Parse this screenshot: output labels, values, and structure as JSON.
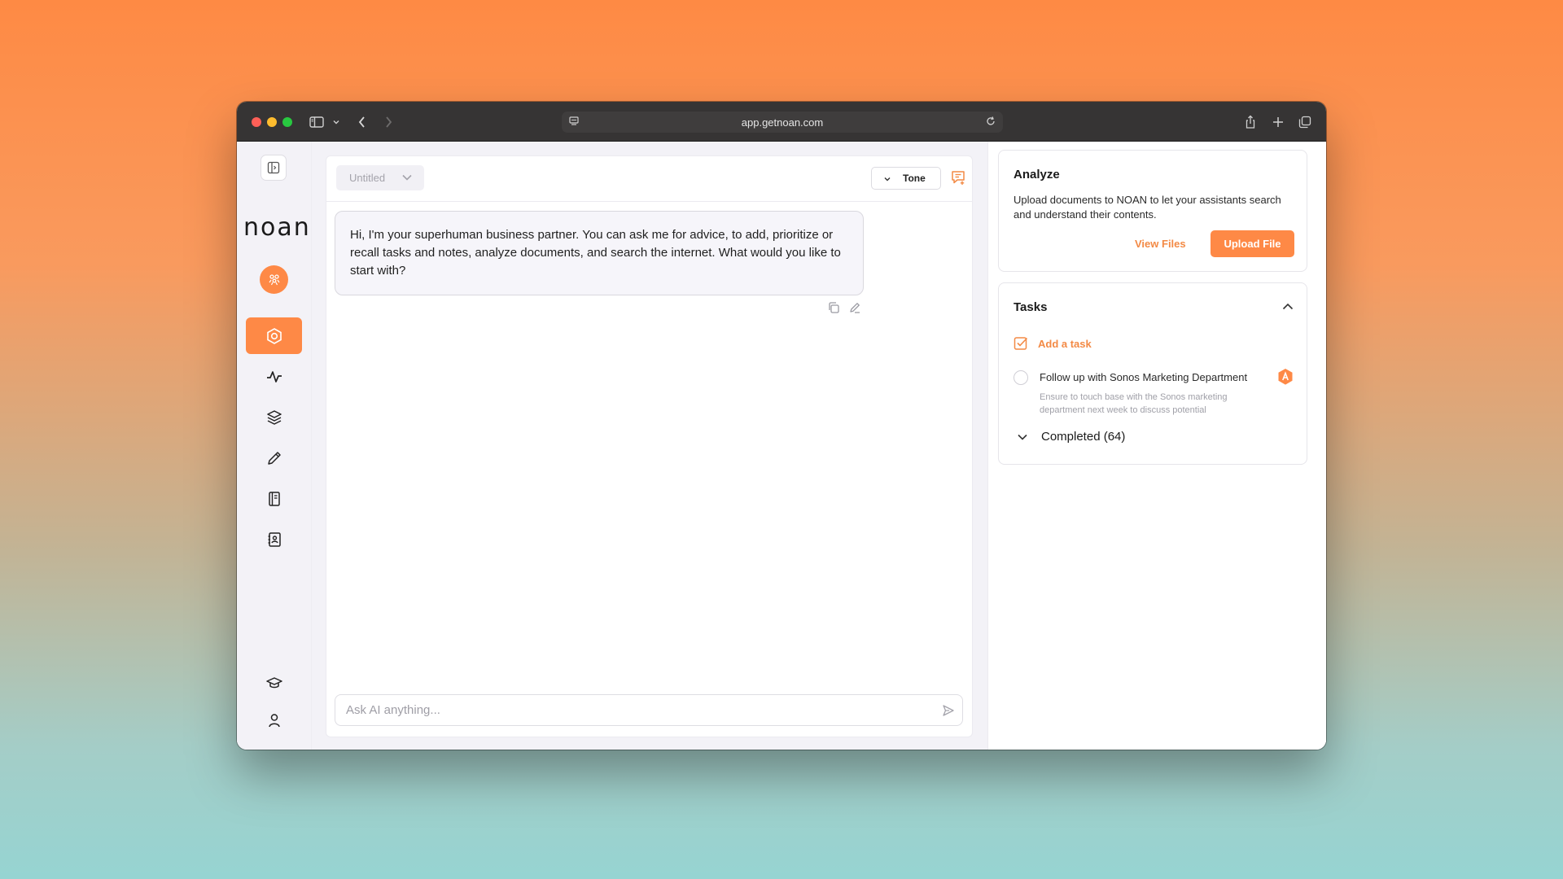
{
  "browser": {
    "url": "app.getnoan.com"
  },
  "app": {
    "logo_text": "noan"
  },
  "chat": {
    "title": "Untitled",
    "tone_label": "Tone",
    "message": "Hi, I'm your superhuman business partner. You can ask me for advice, to add, prioritize or recall tasks and notes, analyze documents, and search the internet. What would you like to start with?",
    "input_placeholder": "Ask AI anything..."
  },
  "analyze": {
    "title": "Analyze",
    "description": "Upload documents to NOAN to let your assistants search and understand their contents.",
    "view_files_label": "View Files",
    "upload_label": "Upload File"
  },
  "tasks": {
    "title": "Tasks",
    "add_label": "Add a task",
    "items": [
      {
        "title": "Follow up with Sonos Marketing Department",
        "description": "Ensure to touch base with the Sonos marketing department next week to discuss potential collaboration opportunities and how NOAN..."
      }
    ],
    "completed_label": "Completed (64)"
  },
  "colors": {
    "accent": "#fe8946",
    "accent_text": "#f38a45"
  }
}
